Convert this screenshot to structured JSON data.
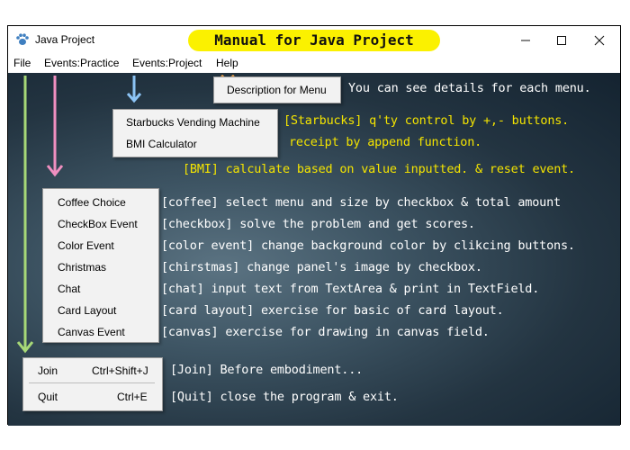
{
  "window": {
    "title": "Java Project",
    "banner": "Manual for Java Project"
  },
  "menubar": [
    "File",
    "Events:Practice",
    "Events:Project",
    "Help"
  ],
  "help_menu": {
    "item": "Description for Menu"
  },
  "project_menu": [
    "Starbucks Vending Machine",
    "BMI Calculator"
  ],
  "practice_menu": [
    "Coffee Choice",
    "CheckBox Event",
    "Color Event",
    "Christmas",
    "Chat",
    "Card Layout",
    "Canvas Event"
  ],
  "file_menu": [
    {
      "label": "Join",
      "shortcut": "Ctrl+Shift+J"
    },
    {
      "label": "Quit",
      "shortcut": "Ctrl+E"
    }
  ],
  "notes": {
    "help": "You can see details for each menu.",
    "starbucks_1": "[Starbucks] q'ty control by +,- buttons.",
    "starbucks_2": "receipt by append function.",
    "bmi": "[BMI] calculate based on value inputted. & reset event.",
    "coffee": "[coffee] select menu and size by checkbox & total amount",
    "checkbox": "[checkbox] solve the problem and get scores.",
    "color": "[color event] change background color by clikcing buttons.",
    "christmas": "[chirstmas] change panel's image by checkbox.",
    "chat": "[chat] input text from TextArea & print in TextField.",
    "card": "[card layout] exercise for basic of card layout.",
    "canvas": "[canvas] exercise for drawing in canvas field.",
    "join": "[Join] Before embodiment...",
    "quit": "[Quit] close the program & exit."
  },
  "colors": {
    "banner": "#fbf100",
    "arrow_file": "#a7d877",
    "arrow_practice": "#f08fc0",
    "arrow_project": "#8cc4f5",
    "arrow_help": "#f4a64a",
    "note_yellow": "#f4e400",
    "note_white": "#ffffff"
  },
  "icons": {
    "app": "paw-icon",
    "minimize": "minimize-icon",
    "maximize": "maximize-icon",
    "close": "close-icon"
  }
}
